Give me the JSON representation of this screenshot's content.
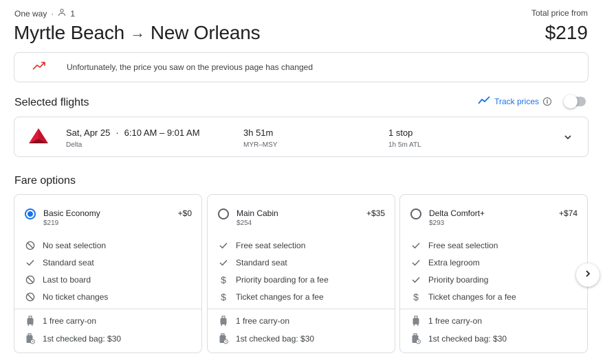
{
  "header": {
    "trip_type": "One way",
    "passengers": "1",
    "origin": "Myrtle Beach",
    "destination": "New Orleans",
    "total_label": "Total price from",
    "total_price": "$219"
  },
  "notice": {
    "message": "Unfortunately, the price you saw on the previous page has changed",
    "icon": "trending-up-icon"
  },
  "selected_flights": {
    "title": "Selected flights",
    "track_label": "Track prices",
    "track_enabled": false,
    "flight": {
      "date": "Sat, Apr 25",
      "times": "6:10 AM – 9:01 AM",
      "airline": "Delta",
      "duration": "3h 51m",
      "route": "MYR–MSY",
      "stops": "1 stop",
      "layover": "1h 5m ATL"
    }
  },
  "fares": {
    "title": "Fare options",
    "options": [
      {
        "name": "Basic Economy",
        "price": "$219",
        "diff": "+$0",
        "selected": true,
        "features": [
          {
            "icon": "not-allowed-icon",
            "text": "No seat selection"
          },
          {
            "icon": "check-icon",
            "text": "Standard seat"
          },
          {
            "icon": "not-allowed-icon",
            "text": "Last to board"
          },
          {
            "icon": "not-allowed-icon",
            "text": "No ticket changes"
          }
        ],
        "bags": [
          "1 free carry-on",
          "1st checked bag: $30"
        ]
      },
      {
        "name": "Main Cabin",
        "price": "$254",
        "diff": "+$35",
        "selected": false,
        "features": [
          {
            "icon": "check-icon",
            "text": "Free seat selection"
          },
          {
            "icon": "check-icon",
            "text": "Standard seat"
          },
          {
            "icon": "dollar-icon",
            "text": "Priority boarding for a fee"
          },
          {
            "icon": "dollar-icon",
            "text": "Ticket changes for a fee"
          }
        ],
        "bags": [
          "1 free carry-on",
          "1st checked bag: $30"
        ]
      },
      {
        "name": "Delta Comfort+",
        "price": "$293",
        "diff": "+$74",
        "selected": false,
        "features": [
          {
            "icon": "check-icon",
            "text": "Free seat selection"
          },
          {
            "icon": "check-icon",
            "text": "Extra legroom"
          },
          {
            "icon": "check-icon",
            "text": "Priority boarding"
          },
          {
            "icon": "dollar-icon",
            "text": "Ticket changes for a fee"
          }
        ],
        "bags": [
          "1 free carry-on",
          "1st checked bag: $30"
        ]
      }
    ]
  },
  "colors": {
    "accent": "#1a73e8",
    "trend_red": "#d93025",
    "delta_red": "#c8102e"
  }
}
